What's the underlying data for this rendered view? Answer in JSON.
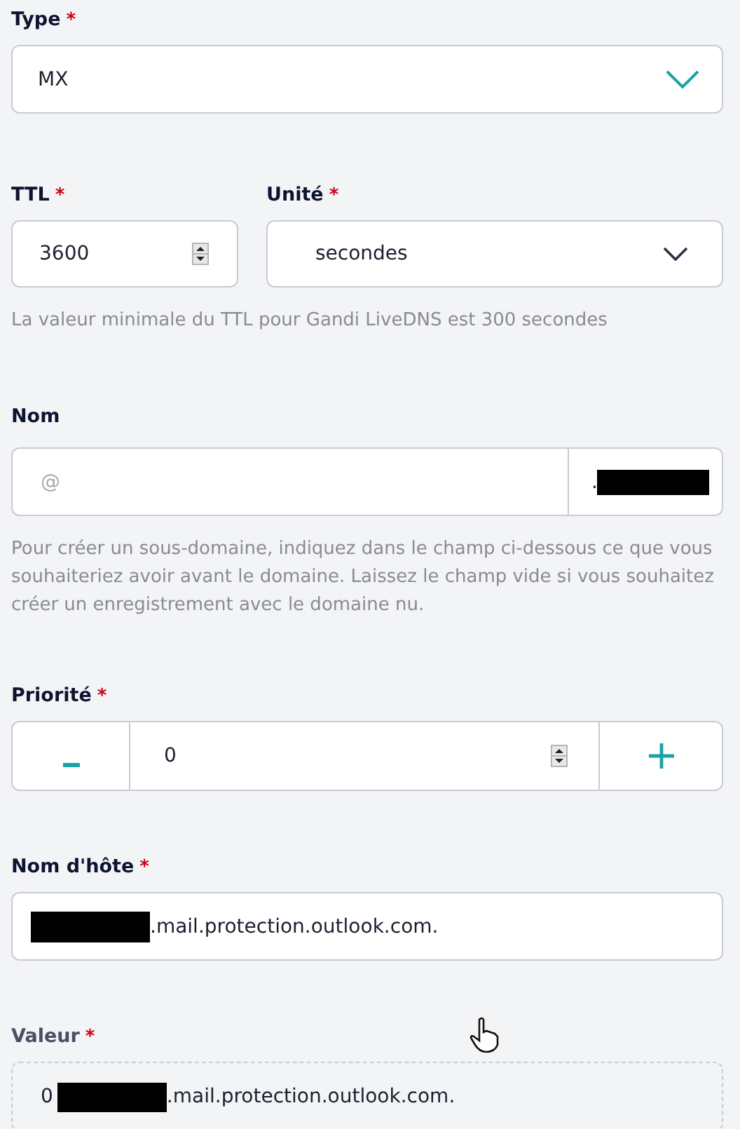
{
  "type_field": {
    "label": "Type",
    "required_mark": "*",
    "value": "MX"
  },
  "ttl_field": {
    "label": "TTL",
    "required_mark": "*",
    "value": "3600"
  },
  "unit_field": {
    "label": "Unité",
    "required_mark": "*",
    "value": "secondes"
  },
  "ttl_hint": "La valeur minimale du TTL pour Gandi LiveDNS est 300 secondes",
  "name_field": {
    "label": "Nom",
    "placeholder": "@",
    "suffix": ".",
    "suffix_redacted": true
  },
  "name_help": "Pour créer un sous-domaine, indiquez dans le champ ci-dessous ce que vous souhaiteriez avoir avant le domaine. Laissez le champ vide si vous souhaitez créer un enregistrement avec le domaine nu.",
  "priority_field": {
    "label": "Priorité",
    "required_mark": "*",
    "value": "0"
  },
  "hostname_field": {
    "label": "Nom d'hôte",
    "required_mark": "*",
    "redacted": true,
    "value": ".mail.protection.outlook.com."
  },
  "value_field": {
    "label": "Valeur",
    "required_mark": "*",
    "prefix": "0",
    "redacted": true,
    "value": ".mail.protection.outlook.com."
  }
}
